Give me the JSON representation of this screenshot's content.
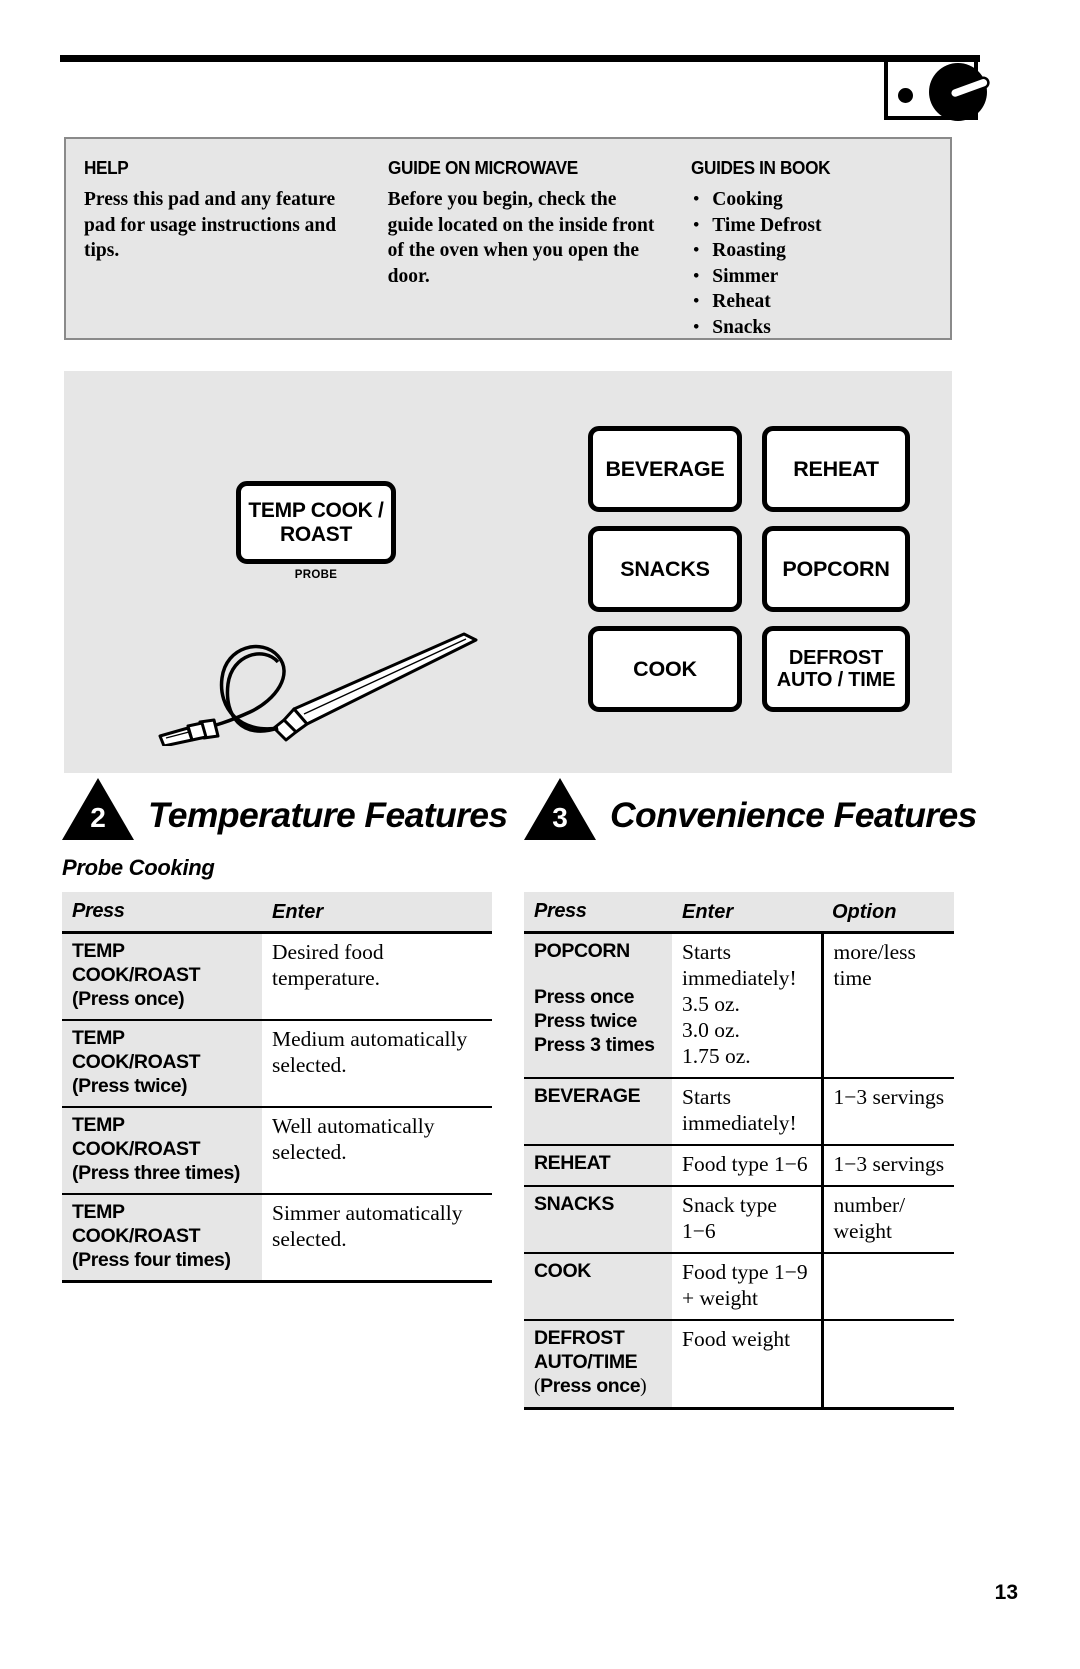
{
  "top_bar": {
    "knob_icon": "knob-dial-icon",
    "indicator_icon": "dot-indicator-icon"
  },
  "info_panel": {
    "columns": [
      {
        "heading": "HELP",
        "body": "Press this pad and any feature pad for usage instructions and tips."
      },
      {
        "heading": "GUIDE ON MICROWAVE",
        "body": "Before you begin, check the guide located on the inside front of the oven when you open the door."
      },
      {
        "heading": "GUIDES IN BOOK",
        "items": [
          "Cooking",
          "Time Defrost",
          "Roasting",
          "Simmer",
          "Reheat",
          "Snacks"
        ]
      }
    ]
  },
  "control_panel": {
    "temp_cook_pad": "TEMP COOK / ROAST",
    "probe_label": "PROBE",
    "probe_icon": "temperature-probe-icon",
    "pads": [
      {
        "label": "BEVERAGE"
      },
      {
        "label": "REHEAT"
      },
      {
        "label": "SNACKS"
      },
      {
        "label": "POPCORN"
      },
      {
        "label": "COOK"
      },
      {
        "label": "DEFROST AUTO / TIME"
      }
    ]
  },
  "sections": [
    {
      "number": "2",
      "title": "Temperature Features"
    },
    {
      "number": "3",
      "title": "Convenience Features"
    }
  ],
  "left_table": {
    "subheading": "Probe Cooking",
    "headers": [
      "Press",
      "Enter"
    ],
    "rows": [
      {
        "press_main": "TEMP COOK/ROAST",
        "press_sub": "(Press once)",
        "enter": "Desired food temperature."
      },
      {
        "press_main": "TEMP COOK/ROAST",
        "press_sub": "(Press twice)",
        "enter": "Medium automatically selected."
      },
      {
        "press_main": "TEMP COOK/ROAST",
        "press_sub": "(Press three times)",
        "enter": "Well automatically selected."
      },
      {
        "press_main": "TEMP COOK/ROAST",
        "press_sub": "(Press four times)",
        "enter": "Simmer automatically selected."
      }
    ]
  },
  "right_table": {
    "headers": [
      "Press",
      "Enter",
      "Option"
    ],
    "rows": [
      {
        "press_main": "POPCORN",
        "press_lines": [
          "Press once",
          "Press twice",
          "Press 3 times"
        ],
        "enter_main": "Starts immediately!",
        "enter_lines": [
          "3.5 oz.",
          "3.0 oz.",
          "1.75 oz."
        ],
        "option": "more/less time"
      },
      {
        "press_main": "BEVERAGE",
        "enter": "Starts immediately!",
        "option": "1−3 servings"
      },
      {
        "press_main": "REHEAT",
        "enter": "Food type 1−6",
        "option": "1−3 servings"
      },
      {
        "press_main": "SNACKS",
        "enter": "Snack type 1−6",
        "option": "number/ weight"
      },
      {
        "press_main": "COOK",
        "enter": "Food type 1−9 + weight",
        "option": ""
      },
      {
        "press_main": "DEFROST AUTO/TIME",
        "press_sub": "(Press once)",
        "enter": "Food weight",
        "option": ""
      }
    ]
  },
  "page_number": "13",
  "colors": {
    "panel_gray": "#e6e6e6",
    "ink": "#000000",
    "panel_border": "#8a8a8a"
  }
}
